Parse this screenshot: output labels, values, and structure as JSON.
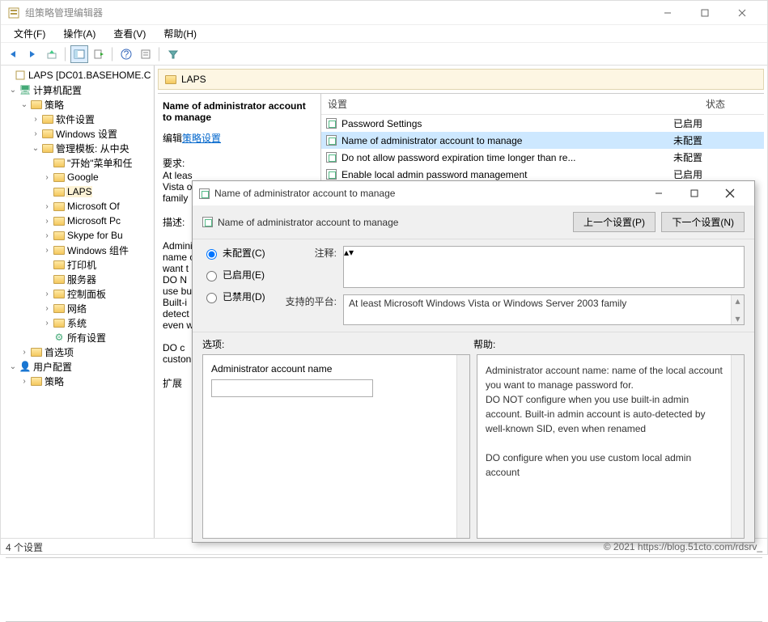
{
  "window": {
    "title": "组策略管理编辑器"
  },
  "menu": {
    "file": "文件(F)",
    "action": "操作(A)",
    "view": "查看(V)",
    "help": "帮助(H)"
  },
  "tree": {
    "root": "LAPS [DC01.BASEHOME.C",
    "computer_config": "计算机配置",
    "policies": "策略",
    "software": "软件设置",
    "windows": "Windows 设置",
    "admin_templates": "管理模板: 从中央",
    "start_menu": "\"开始\"菜单和任",
    "google": "Google",
    "laps": "LAPS",
    "ms_of": "Microsoft Of",
    "ms_pc": "Microsoft Pc",
    "skype": "Skype for Bu",
    "win_comp": "Windows 组件",
    "printers": "打印机",
    "servers": "服务器",
    "ctrl_panel": "控制面板",
    "network": "网络",
    "system": "系统",
    "all_settings": "所有设置",
    "preferences": "首选项",
    "user_config": "用户配置",
    "policies2": "策略"
  },
  "crumb": "LAPS",
  "desc": {
    "title": "Name of administrator account to manage",
    "edit_prefix": "编辑",
    "edit_link": "策略设置",
    "req_label": "要求:",
    "req_text1": "At leas",
    "req_text2": "Vista o",
    "req_text3": "family",
    "desc_label": "描述:",
    "d1": "Admini",
    "d2": "name o",
    "d3": "want t",
    "d4": "  DO N",
    "d5": "use bu",
    "d6": "Built-i",
    "d7": "detect",
    "d8": "even w",
    "d9": "  DO c",
    "d10": "custon",
    "tab": "扩展"
  },
  "list": {
    "col_setting": "设置",
    "col_status": "状态",
    "rows": [
      {
        "name": "Password Settings",
        "status": "已启用"
      },
      {
        "name": "Name of administrator account to manage",
        "status": "未配置"
      },
      {
        "name": "Do not allow password expiration time longer than re...",
        "status": "未配置"
      },
      {
        "name": "Enable local admin password management",
        "status": "已启用"
      }
    ]
  },
  "status": "4 个设置",
  "dialog": {
    "title": "Name of administrator account to manage",
    "subtitle": "Name of administrator account to manage",
    "prev": "上一个设置(P)",
    "next": "下一个设置(N)",
    "radio_notconf": "未配置(C)",
    "radio_enabled": "已启用(E)",
    "radio_disabled": "已禁用(D)",
    "comment_label": "注释:",
    "platform_label": "支持的平台:",
    "platform_text": "At least Microsoft Windows Vista or Windows Server 2003 family",
    "options_label": "选项:",
    "help_label": "帮助:",
    "opt_field": "Administrator account name",
    "help_text1": "Administrator account name: name of the local account you want to manage password for.",
    "help_text2": "  DO NOT configure when you use built-in admin account. Built-in admin account is auto-detected by well-known SID, even when renamed",
    "help_text3": "  DO configure when you use custom local admin account"
  },
  "watermark": "© 2021 https://blog.51cto.com/rdsrv_"
}
